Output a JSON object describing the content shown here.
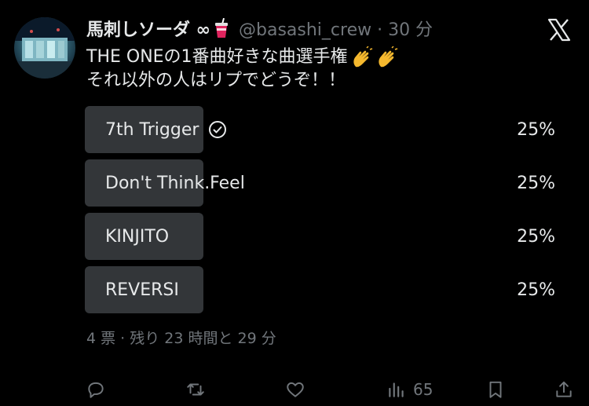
{
  "author": {
    "name": "馬刺しソーダ ∞",
    "handle": "@basashi_crew · 30 分"
  },
  "tweet": {
    "line1": "THE ONEの1番曲好きな曲選手権",
    "line2": "それ以外の人はリプでどうぞ！！"
  },
  "poll": {
    "options": [
      {
        "label": "7th Trigger",
        "percent": "25%",
        "value": 25,
        "selected": true
      },
      {
        "label": "Don't Think.Feel",
        "percent": "25%",
        "value": 25,
        "selected": false
      },
      {
        "label": "KINJITO",
        "percent": "25%",
        "value": 25,
        "selected": false
      },
      {
        "label": "REVERSI",
        "percent": "25%",
        "value": 25,
        "selected": false
      }
    ],
    "meta": "4 票 · 残り 23 時間と 29 分"
  },
  "actions": {
    "views_count": "65"
  },
  "colors": {
    "background": "#000000",
    "text": "#e7e9ea",
    "muted": "#71767b",
    "poll_fill": "#333639"
  },
  "icons": [
    "reply-icon",
    "retweet-icon",
    "like-icon",
    "views-icon",
    "bookmark-icon",
    "share-icon",
    "check-circle-icon",
    "x-logo-icon",
    "clapping-hands-icon",
    "cup-icon"
  ]
}
